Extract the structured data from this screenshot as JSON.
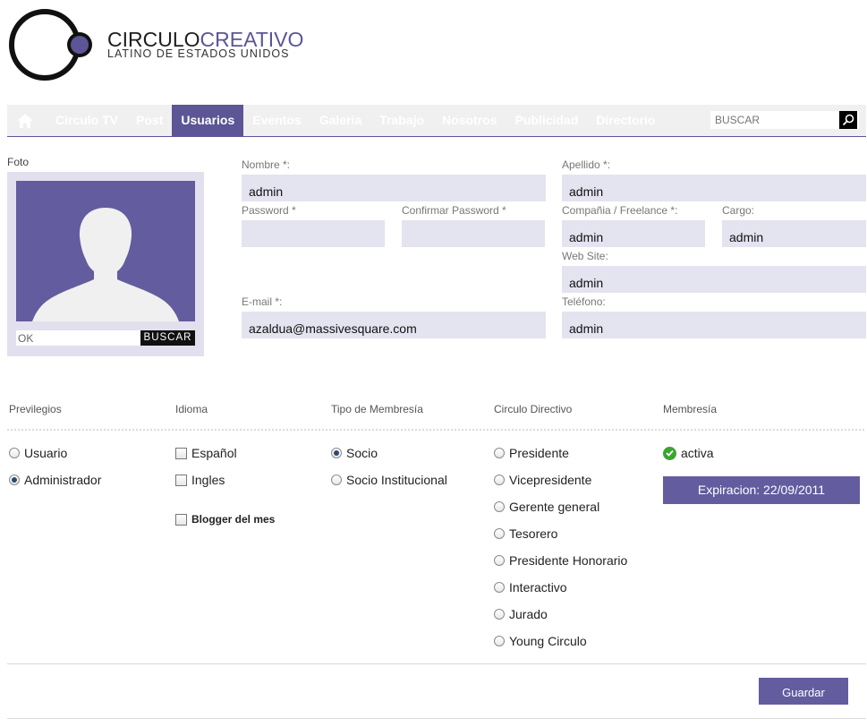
{
  "brand": {
    "circulo": "CIRCULO",
    "creativo": "CREATIVO",
    "tagline": "LATINO DE ESTADOS UNIDOS",
    "accent": "#5c5596"
  },
  "nav": {
    "items": [
      "Circulo TV",
      "Post",
      "Usuarios",
      "Eventos",
      "Galeria",
      "Trabajo",
      "Nosotros",
      "Publicidad",
      "Directorio"
    ],
    "active": "Usuarios",
    "search_placeholder": "BUSCAR",
    "home_icon": "home-icon",
    "search_icon": "search-icon"
  },
  "photo": {
    "label": "Foto",
    "input_value": "OK",
    "button_label": "BUSCAR"
  },
  "form": {
    "nombre": {
      "label": "Nombre *:",
      "value": "admin"
    },
    "apellido": {
      "label": "Apellido *:",
      "value": "admin"
    },
    "password": {
      "label": "Password *",
      "value": ""
    },
    "confirm_password": {
      "label": "Confirmar Password *",
      "value": ""
    },
    "compania": {
      "label": "Compañia / Freelance *:",
      "value": "admin"
    },
    "cargo": {
      "label": "Cargo:",
      "value": "admin"
    },
    "website": {
      "label": "Web Site:",
      "value": "admin"
    },
    "email": {
      "label": "E-mail *:",
      "value": "azaldua@massivesquare.com"
    },
    "telefono": {
      "label": "Teléfono:",
      "value": "admin"
    }
  },
  "options": {
    "privilegios": {
      "header": "Previlegios",
      "items": [
        "Usuario",
        "Administrador"
      ],
      "selected": "Administrador"
    },
    "idioma": {
      "header": "Idioma",
      "items": [
        "Español",
        "Ingles"
      ],
      "blogger": "Blogger del mes"
    },
    "membresia_tipo": {
      "header": "Tipo de Membresía",
      "items": [
        "Socio",
        "Socio Institucional"
      ],
      "selected": "Socio"
    },
    "circulo_directivo": {
      "header": "Circulo Directivo",
      "items": [
        "Presidente",
        "Vicepresidente",
        "Gerente general",
        "Tesorero",
        "Presidente Honorario",
        "Interactivo",
        "Jurado",
        "Young Circulo"
      ]
    },
    "membresia": {
      "header": "Membresía",
      "status": "activa",
      "status_icon": "check-circle-icon",
      "expiration": "Expiracion: 22/09/2011"
    }
  },
  "save_label": "Guardar"
}
